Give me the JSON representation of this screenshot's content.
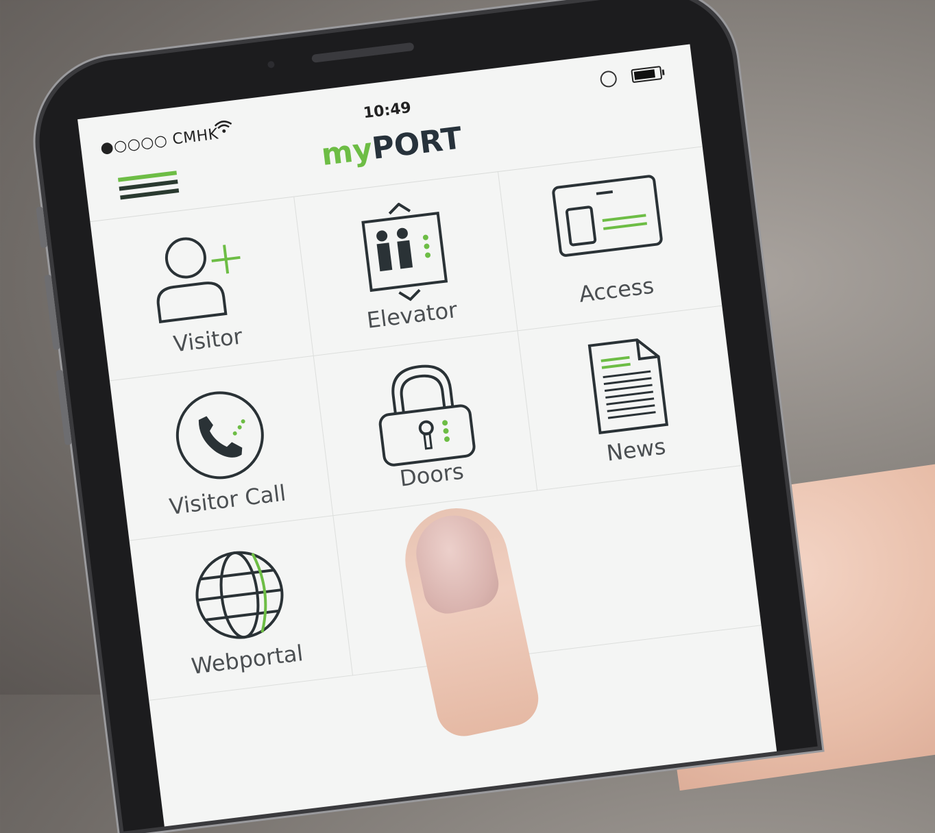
{
  "status_bar": {
    "carrier": "●○○○○ CMHK",
    "time": "10:49"
  },
  "app": {
    "title_prefix": "my",
    "title_suffix": "PORT"
  },
  "tiles": [
    {
      "label": "Visitor",
      "icon": "add-person-icon"
    },
    {
      "label": "Elevator",
      "icon": "elevator-icon"
    },
    {
      "label": "Access",
      "icon": "access-card-icon"
    },
    {
      "label": "Visitor Call",
      "icon": "phone-icon"
    },
    {
      "label": "Doors",
      "icon": "padlock-icon"
    },
    {
      "label": "News",
      "icon": "document-icon"
    },
    {
      "label": "Webportal",
      "icon": "globe-icon"
    }
  ],
  "colors": {
    "accent": "#6dbd45",
    "icon_stroke": "#2a3236",
    "screen_bg": "#f4f5f4"
  }
}
